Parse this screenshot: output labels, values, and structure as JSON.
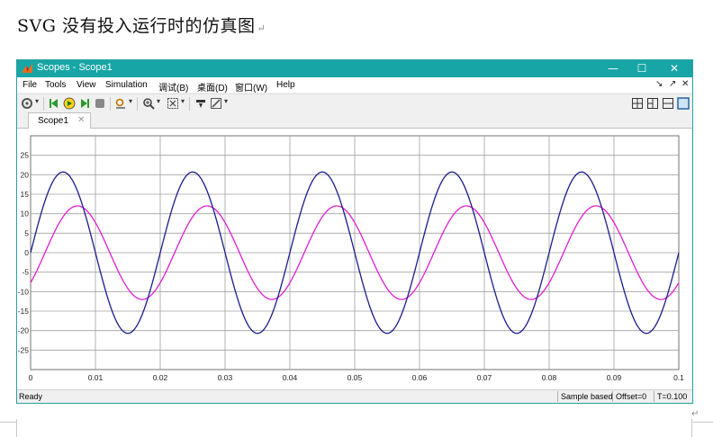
{
  "document": {
    "heading": "SVG 没有投入运行时的仿真图",
    "paragraph_mark": "↵"
  },
  "window": {
    "title": "Scopes - Scope1",
    "controls": {
      "minimize": "—",
      "maximize": "☐",
      "close": "✕"
    }
  },
  "menu": {
    "items": [
      "File",
      "Tools",
      "View",
      "Simulation",
      "调试(B)",
      "桌面(D)",
      "窗口(W)",
      "Help"
    ],
    "dock_controls": [
      "↘",
      "↗",
      "✕"
    ]
  },
  "toolbar": {
    "icons": [
      "gear-icon",
      "step-back-icon",
      "run-icon",
      "step-forward-icon",
      "stop-icon",
      "highlight-icon",
      "zoom-icon",
      "fit-icon",
      "cursor-icon",
      "style-icon"
    ],
    "layout_icons": [
      "layout-grid-icon",
      "layout-cols-icon",
      "layout-rows-icon",
      "layout-single-icon"
    ]
  },
  "tab": {
    "label": "Scope1",
    "close": "✕"
  },
  "status": {
    "ready": "Ready",
    "mode": "Sample based",
    "offset": "Offset=0",
    "time": "T=0.100"
  },
  "colors": {
    "titlebar": "#18a5a5",
    "series1": "#1c1c8c",
    "series2": "#e020d0",
    "grid": "#a0a0a0"
  },
  "chart_data": {
    "type": "line",
    "title": "",
    "xlabel": "",
    "ylabel": "",
    "xlim": [
      0,
      0.1
    ],
    "ylim": [
      -30,
      30
    ],
    "x_ticks": [
      "0",
      "0.01",
      "0.02",
      "0.03",
      "0.04",
      "0.05",
      "0.06",
      "0.07",
      "0.08",
      "0.09",
      "0.1"
    ],
    "y_ticks": [
      "25",
      "20",
      "15",
      "10",
      "5",
      "0",
      "-5",
      "-10",
      "-15",
      "-20",
      "-25"
    ],
    "grid": true,
    "series": [
      {
        "amplitude": 20.7,
        "frequency_hz": 50,
        "phase_deg": 0,
        "color": "#1c1c8c"
      },
      {
        "amplitude": 12.0,
        "frequency_hz": 50,
        "phase_deg": -40,
        "color": "#e020d0"
      }
    ]
  }
}
